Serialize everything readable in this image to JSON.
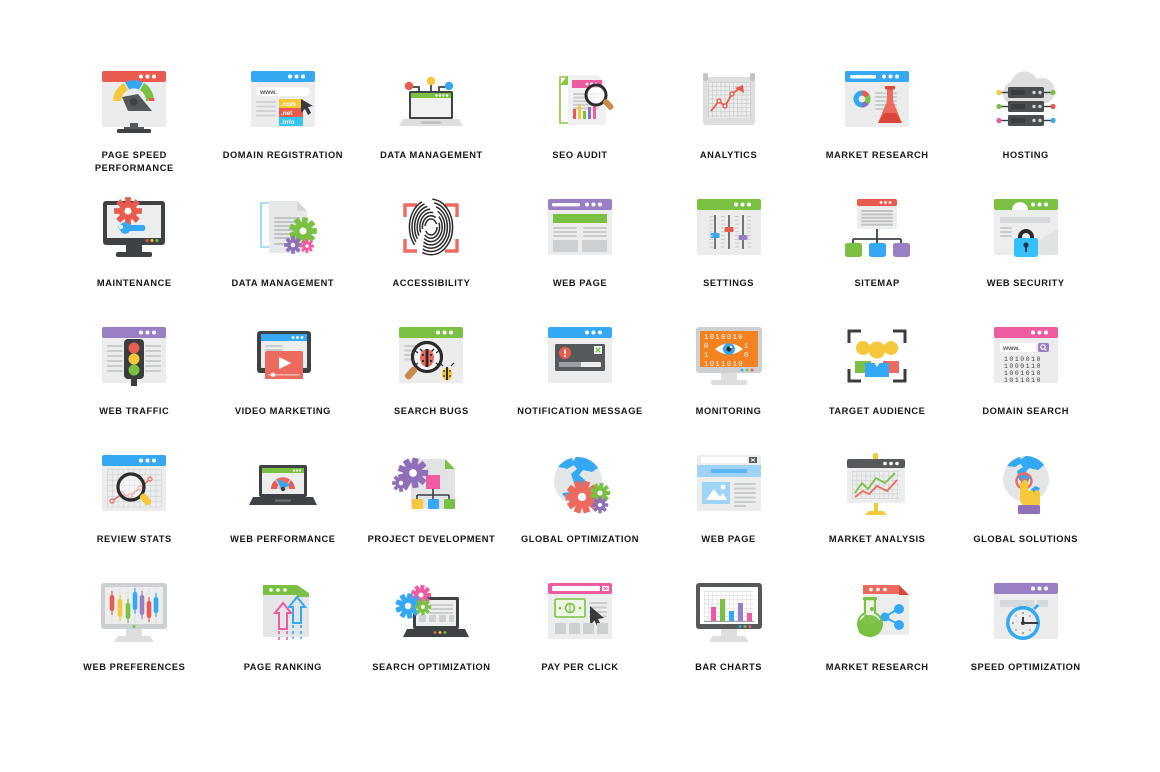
{
  "page": {
    "background": "#ffffff",
    "label_color": "#161616",
    "columns": 7,
    "rows": 5,
    "total_icons": 35,
    "title_style": "uppercase-bold"
  },
  "palette": {
    "red": "#ea5b4f",
    "coral": "#ec6a5e",
    "blue": "#34a8f2",
    "light_blue": "#4fb3f6",
    "green": "#7ac143",
    "green_alt": "#8cc63f",
    "yellow": "#f5c83b",
    "purple": "#9b7fc4",
    "violet": "#8e6fb8",
    "pink": "#ef5ba1",
    "magenta": "#ec4899",
    "orange": "#f58220",
    "grey_dark": "#4a4a4a",
    "grey_mid": "#9aa0a6",
    "grey_light": "#e3e5e7",
    "grey_panel": "#eceded"
  },
  "icons": [
    {
      "id": "page-speed-performance",
      "label": "PAGE SPEED\nPERFORMANCE",
      "art": "gauge-browser",
      "accent": "#ea5b4f",
      "row": 1,
      "col": 1
    },
    {
      "id": "domain-registration",
      "label": "DOMAIN REGISTRATION",
      "art": "domain-browser",
      "accent": "#34a8f2",
      "row": 1,
      "col": 2,
      "details": {
        "url_text": "www.",
        "tags": [
          ".com",
          ".net",
          ".info"
        ],
        "tag_colors": [
          "#f5c83b",
          "#ea5b4f",
          "#34c5f4"
        ]
      }
    },
    {
      "id": "data-management-laptop",
      "label": "DATA MANAGEMENT",
      "art": "laptop-nodes",
      "accent": "#7ac143",
      "row": 1,
      "col": 3,
      "details": {
        "node_colors": [
          "#ea5b4f",
          "#f5c83b",
          "#34a8f2"
        ]
      }
    },
    {
      "id": "seo-audit",
      "label": "SEO AUDIT",
      "art": "seo-audit-doc",
      "accent": "#ef5ba1",
      "row": 1,
      "col": 4
    },
    {
      "id": "analytics",
      "label": "ANALYTICS",
      "art": "analytics-grid",
      "accent": "#ea5b4f",
      "row": 1,
      "col": 5
    },
    {
      "id": "market-research-flask",
      "label": "MARKET RESEARCH",
      "art": "browser-flask",
      "accent": "#34a8f2",
      "row": 1,
      "col": 6
    },
    {
      "id": "hosting",
      "label": "HOSTING",
      "art": "cloud-servers",
      "accent": "#4a4a4a",
      "row": 1,
      "col": 7,
      "details": {
        "node_colors": [
          "#f5c83b",
          "#7ac143",
          "#7ac143",
          "#ea5b4f",
          "#ef5ba1",
          "#34a8f2"
        ]
      }
    },
    {
      "id": "maintenance",
      "label": "MAINTENANCE",
      "art": "monitor-gear-wrench",
      "accent": "#ea5b4f",
      "row": 2,
      "col": 1
    },
    {
      "id": "data-management-doc",
      "label": "DATA MANAGEMENT",
      "art": "doc-gears",
      "accent": "#7ac143",
      "row": 2,
      "col": 2
    },
    {
      "id": "accessibility",
      "label": "ACCESSIBILITY",
      "art": "fingerprint-scan",
      "accent": "#ea5b4f",
      "row": 2,
      "col": 3
    },
    {
      "id": "web-page-purple",
      "label": "WEB PAGE",
      "art": "webpage-purple",
      "accent": "#9b7fc4",
      "row": 2,
      "col": 4
    },
    {
      "id": "settings",
      "label": "SETTINGS",
      "art": "sliders-browser",
      "accent": "#7ac143",
      "row": 2,
      "col": 5,
      "details": {
        "knob_colors": [
          "#34a8f2",
          "#ea5b4f",
          "#9b7fc4"
        ]
      }
    },
    {
      "id": "sitemap",
      "label": "SITEMAP",
      "art": "sitemap-tree",
      "accent": "#ea5b4f",
      "row": 2,
      "col": 6,
      "details": {
        "node_colors": [
          "#7ac143",
          "#34a8f2",
          "#9b7fc4"
        ]
      }
    },
    {
      "id": "web-security",
      "label": "WEB SECURITY",
      "art": "browser-lock",
      "accent": "#7ac143",
      "row": 2,
      "col": 7
    },
    {
      "id": "web-traffic",
      "label": "WEB TRAFFIC",
      "art": "traffic-light-browser",
      "accent": "#9b7fc4",
      "row": 3,
      "col": 1,
      "details": {
        "lights": [
          "#ea5b4f",
          "#f5c83b",
          "#7ac143"
        ]
      }
    },
    {
      "id": "video-marketing",
      "label": "VIDEO MARKETING",
      "art": "tablet-video",
      "accent": "#34a8f2",
      "row": 3,
      "col": 2
    },
    {
      "id": "search-bugs",
      "label": "SEARCH BUGS",
      "art": "bug-magnifier",
      "accent": "#7ac143",
      "row": 3,
      "col": 3
    },
    {
      "id": "notification-message",
      "label": "NOTIFICATION MESSAGE",
      "art": "alert-dialog",
      "accent": "#34a8f2",
      "row": 3,
      "col": 4
    },
    {
      "id": "monitoring",
      "label": "MONITORING",
      "art": "monitor-eye-binary",
      "accent": "#f58220",
      "row": 3,
      "col": 5,
      "details": {
        "binary_rows": [
          "1010010",
          "0      1",
          "1      0",
          "1011010"
        ]
      }
    },
    {
      "id": "target-audience",
      "label": "TARGET AUDIENCE",
      "art": "people-frame",
      "accent": "#4a4a4a",
      "row": 3,
      "col": 6
    },
    {
      "id": "domain-search",
      "label": "DOMAIN SEARCH",
      "art": "domain-search-browser",
      "accent": "#ef5ba1",
      "row": 3,
      "col": 7,
      "details": {
        "url_text": "www.",
        "binary_rows": [
          "1010010",
          "1000110",
          "1001010",
          "1011010"
        ]
      }
    },
    {
      "id": "review-stats",
      "label": "REVIEW STATS",
      "art": "chart-magnifier",
      "accent": "#34a8f2",
      "row": 4,
      "col": 1
    },
    {
      "id": "web-performance",
      "label": "WEB PERFORMANCE",
      "art": "laptop-gauge",
      "accent": "#7ac143",
      "row": 4,
      "col": 2
    },
    {
      "id": "project-development",
      "label": "PROJECT DEVELOPMENT",
      "art": "doc-flow-gear",
      "accent": "#9b7fc4",
      "row": 4,
      "col": 3,
      "details": {
        "node_colors": [
          "#f5c83b",
          "#34a8f2",
          "#7ac143"
        ],
        "head_color": "#ef5ba1"
      }
    },
    {
      "id": "global-optimization",
      "label": "GLOBAL OPTIMIZATION",
      "art": "globe-gears",
      "accent": "#ea5b4f",
      "row": 4,
      "col": 4
    },
    {
      "id": "web-page-blue",
      "label": "WEB PAGE",
      "art": "webpage-image",
      "accent": "#34a8f2",
      "row": 4,
      "col": 5
    },
    {
      "id": "market-analysis",
      "label": "MARKET ANALYSIS",
      "art": "presentation-chart",
      "accent": "#f5c83b",
      "row": 4,
      "col": 6
    },
    {
      "id": "global-solutions",
      "label": "GLOBAL SOLUTIONS",
      "art": "globe-touch",
      "accent": "#34a8f2",
      "row": 4,
      "col": 7
    },
    {
      "id": "web-preferences",
      "label": "WEB PREFERENCES",
      "art": "monitor-candles",
      "accent": "#4a4a4a",
      "row": 5,
      "col": 1,
      "details": {
        "candle_colors": [
          "#ea5b4f",
          "#f5c83b",
          "#7ac143",
          "#34a8f2",
          "#9b7fc4",
          "#ea5b4f",
          "#34a8f2"
        ]
      }
    },
    {
      "id": "page-ranking",
      "label": "PAGE RANKING",
      "art": "doc-arrows-up",
      "accent": "#7ac143",
      "row": 5,
      "col": 2,
      "details": {
        "arrow_colors": [
          "#ef5ba1",
          "#34a8f2"
        ]
      }
    },
    {
      "id": "search-optimization",
      "label": "SEARCH OPTIMIZATION",
      "art": "laptop-gears",
      "accent": "#34a8f2",
      "row": 5,
      "col": 3,
      "details": {
        "gear_colors": [
          "#ef5ba1",
          "#34a8f2",
          "#7ac143"
        ]
      }
    },
    {
      "id": "pay-per-click",
      "label": "PAY PER CLICK",
      "art": "browser-money-cursor",
      "accent": "#ef5ba1",
      "row": 5,
      "col": 4
    },
    {
      "id": "bar-charts",
      "label": "BAR CHARTS",
      "art": "monitor-bars",
      "accent": "#4a4a4a",
      "row": 5,
      "col": 5,
      "details": {
        "bar_colors": [
          "#ef5ba1",
          "#7ac143",
          "#34a8f2",
          "#9b7fc4"
        ]
      }
    },
    {
      "id": "market-research-share",
      "label": "MARKET RESEARCH",
      "art": "flask-share",
      "accent": "#ea5b4f",
      "row": 5,
      "col": 6
    },
    {
      "id": "speed-optimization",
      "label": "SPEED OPTIMIZATION",
      "art": "browser-stopwatch",
      "accent": "#9b7fc4",
      "row": 5,
      "col": 7
    }
  ]
}
